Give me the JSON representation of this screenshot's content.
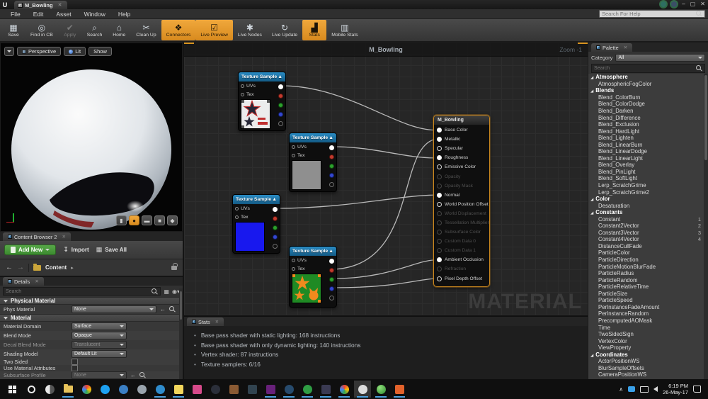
{
  "colors": {
    "accent_orange": "#E8962E",
    "node_header_blue": "#1E78A8",
    "add_new_green": "#4C9A3F",
    "wire_gray": "#C9C9C9",
    "selection_orange_border": "#C8861E"
  },
  "window": {
    "tab_title": "M_Bowling",
    "help_search_placeholder": "Search For Help",
    "menu": [
      "File",
      "Edit",
      "Asset",
      "Window",
      "Help"
    ]
  },
  "toolbar": {
    "buttons": [
      {
        "label": "Save",
        "icon": "save-icon",
        "glyph": "▦",
        "state": "normal"
      },
      {
        "label": "Find in CB",
        "icon": "find-in-cb-icon",
        "glyph": "◎",
        "state": "normal"
      },
      {
        "label": "Apply",
        "icon": "apply-icon",
        "glyph": "✔",
        "state": "disabled"
      },
      {
        "label": "Search",
        "icon": "search-icon",
        "glyph": "⌕",
        "state": "normal"
      },
      {
        "label": "Home",
        "icon": "home-icon",
        "glyph": "⌂",
        "state": "normal"
      },
      {
        "label": "Clean Up",
        "icon": "clean-up-icon",
        "glyph": "✂",
        "state": "normal"
      },
      {
        "label": "Connectors",
        "icon": "connectors-icon",
        "glyph": "❖",
        "state": "active"
      },
      {
        "label": "Live Preview",
        "icon": "live-preview-icon",
        "glyph": "☑",
        "state": "active"
      },
      {
        "label": "Live Nodes",
        "icon": "live-nodes-icon",
        "glyph": "✱",
        "state": "normal"
      },
      {
        "label": "Live Update",
        "icon": "live-update-icon",
        "glyph": "↻",
        "state": "normal"
      },
      {
        "label": "Stats",
        "icon": "stats-icon",
        "glyph": "▟",
        "state": "active"
      },
      {
        "label": "Mobile Stats",
        "icon": "mobile-stats-icon",
        "glyph": "▥",
        "state": "normal"
      }
    ]
  },
  "viewport": {
    "perspective": "Perspective",
    "lit": "Lit",
    "show": "Show"
  },
  "content_browser": {
    "tab": "Content Browser 2",
    "add_new": "Add New",
    "import": "Import",
    "save_all": "Save All",
    "path": "Content"
  },
  "details": {
    "tab": "Details",
    "search_placeholder": "Search",
    "physical_material_header": "Physical Material",
    "phys_material_label": "Phys Material",
    "phys_material_value": "None",
    "material_header": "Material",
    "rows": [
      {
        "label": "Material Domain",
        "value": "Surface",
        "state": "normal"
      },
      {
        "label": "Blend Mode",
        "value": "Opaque",
        "state": "normal"
      },
      {
        "label": "Decal Blend Mode",
        "value": "Translucent",
        "state": "disabled"
      },
      {
        "label": "Shading Model",
        "value": "Default Lit",
        "state": "normal"
      }
    ],
    "two_sided_label": "Two Sided",
    "use_material_attributes_label": "Use Material Attributes",
    "subsurface_profile_label": "Subsurface Profile",
    "subsurface_profile_value": "None"
  },
  "graph": {
    "title": "M_Bowling",
    "zoom": "Zoom -1",
    "watermark": "MATERIAL",
    "texture_node": {
      "title": "Texture Sample",
      "uvs": "UVs",
      "tex": "Tex"
    },
    "output_node": {
      "title": "M_Bowling",
      "pins": [
        {
          "label": "Base Color",
          "state": "connected"
        },
        {
          "label": "Metallic",
          "state": "connected"
        },
        {
          "label": "Specular",
          "state": "open"
        },
        {
          "label": "Roughness",
          "state": "connected"
        },
        {
          "label": "Emissive Color",
          "state": "open"
        },
        {
          "label": "Opacity",
          "state": "disabled"
        },
        {
          "label": "Opacity Mask",
          "state": "disabled"
        },
        {
          "label": "Normal",
          "state": "connected"
        },
        {
          "label": "World Position Offset",
          "state": "open"
        },
        {
          "label": "World Displacement",
          "state": "disabled"
        },
        {
          "label": "Tessellation Multiplier",
          "state": "disabled"
        },
        {
          "label": "Subsurface Color",
          "state": "disabled"
        },
        {
          "label": "Custom Data 0",
          "state": "disabled"
        },
        {
          "label": "Custom Data 1",
          "state": "disabled"
        },
        {
          "label": "Ambient Occlusion",
          "state": "connected"
        },
        {
          "label": "Refraction",
          "state": "disabled"
        },
        {
          "label": "Pixel Depth Offset",
          "state": "open"
        }
      ]
    }
  },
  "stats": {
    "tab": "Stats",
    "lines": [
      "Base pass shader with static lighting: 168 instructions",
      "Base pass shader with only dynamic lighting: 140 instructions",
      "Vertex shader: 87 instructions",
      "Texture samplers: 6/16"
    ]
  },
  "palette": {
    "tab": "Palette",
    "category_label": "Category",
    "category_value": "All",
    "search_placeholder": "Search",
    "items": [
      {
        "label": "Atmosphere",
        "type": "hdr"
      },
      {
        "label": "AtmosphericFogColor",
        "type": "itm"
      },
      {
        "label": "Blends",
        "type": "hdr"
      },
      {
        "label": "Blend_ColorBurn",
        "type": "itm"
      },
      {
        "label": "Blend_ColorDodge",
        "type": "itm"
      },
      {
        "label": "Blend_Darken",
        "type": "itm"
      },
      {
        "label": "Blend_Difference",
        "type": "itm"
      },
      {
        "label": "Blend_Exclusion",
        "type": "itm"
      },
      {
        "label": "Blend_HardLight",
        "type": "itm"
      },
      {
        "label": "Blend_Lighten",
        "type": "itm"
      },
      {
        "label": "Blend_LinearBurn",
        "type": "itm"
      },
      {
        "label": "Blend_LinearDodge",
        "type": "itm"
      },
      {
        "label": "Blend_LinearLight",
        "type": "itm"
      },
      {
        "label": "Blend_Overlay",
        "type": "itm"
      },
      {
        "label": "Blend_PinLight",
        "type": "itm"
      },
      {
        "label": "Blend_SoftLight",
        "type": "itm"
      },
      {
        "label": "Lerp_ScratchGrime",
        "type": "itm"
      },
      {
        "label": "Lerp_ScratchGrime2",
        "type": "itm"
      },
      {
        "label": "Color",
        "type": "hdr"
      },
      {
        "label": "Desaturation",
        "type": "itm"
      },
      {
        "label": "Constants",
        "type": "hdr"
      },
      {
        "label": "Constant",
        "type": "itm",
        "badge": "1"
      },
      {
        "label": "Constant2Vector",
        "type": "itm",
        "badge": "2"
      },
      {
        "label": "Constant3Vector",
        "type": "itm",
        "badge": "3"
      },
      {
        "label": "Constant4Vector",
        "type": "itm",
        "badge": "4"
      },
      {
        "label": "DistanceCullFade",
        "type": "itm"
      },
      {
        "label": "ParticleColor",
        "type": "itm"
      },
      {
        "label": "ParticleDirection",
        "type": "itm"
      },
      {
        "label": "ParticleMotionBlurFade",
        "type": "itm"
      },
      {
        "label": "ParticleRadius",
        "type": "itm"
      },
      {
        "label": "ParticleRandom",
        "type": "itm"
      },
      {
        "label": "ParticleRelativeTime",
        "type": "itm"
      },
      {
        "label": "ParticleSize",
        "type": "itm"
      },
      {
        "label": "ParticleSpeed",
        "type": "itm"
      },
      {
        "label": "PerInstanceFadeAmount",
        "type": "itm"
      },
      {
        "label": "PerInstanceRandom",
        "type": "itm"
      },
      {
        "label": "PrecomputedAOMask",
        "type": "itm"
      },
      {
        "label": "Time",
        "type": "itm"
      },
      {
        "label": "TwoSidedSign",
        "type": "itm"
      },
      {
        "label": "VertexColor",
        "type": "itm"
      },
      {
        "label": "ViewProperty",
        "type": "itm"
      },
      {
        "label": "Coordinates",
        "type": "hdr"
      },
      {
        "label": "ActorPositionWS",
        "type": "itm"
      },
      {
        "label": "BlurSampleOffsets",
        "type": "itm"
      },
      {
        "label": "CameraPositionWS",
        "type": "itm"
      }
    ]
  },
  "taskbar": {
    "time": "6:19 PM",
    "date": "26-May-17",
    "icons": [
      {
        "name": "cortana-icon",
        "color": "transparent",
        "shape": "ring",
        "state": "normal"
      },
      {
        "name": "contrast-circle-icon",
        "color": "linear-gradient(90deg,#e8e8e8 50%,#555 50%)",
        "shape": "circle",
        "state": "normal"
      },
      {
        "name": "file-explorer-icon",
        "color": "#e8c35a",
        "shape": "folder",
        "state": "open"
      },
      {
        "name": "chrome-icon",
        "color": "conic-gradient(#ea4335,#fbbc05,#34a853,#4285f4,#ea4335)",
        "shape": "circle",
        "state": "normal"
      },
      {
        "name": "twitter-icon",
        "color": "#1da1f2",
        "shape": "circle",
        "state": "normal"
      },
      {
        "name": "globe-icon",
        "color": "#3b7fc4",
        "shape": "circle",
        "state": "normal"
      },
      {
        "name": "camera-icon",
        "color": "#9aa4ad",
        "shape": "circle",
        "state": "normal"
      },
      {
        "name": "edge-icon",
        "color": "#2f8ccc",
        "shape": "circle",
        "state": "open"
      },
      {
        "name": "sticky-notes-icon",
        "color": "#f2d65c",
        "shape": "square",
        "state": "open"
      },
      {
        "name": "photos-icon",
        "color": "#d64a8a",
        "shape": "square",
        "state": "normal"
      },
      {
        "name": "steam-icon",
        "color": "#2b2f3a",
        "shape": "circle",
        "state": "normal"
      },
      {
        "name": "package-icon",
        "color": "#8a5a33",
        "shape": "square",
        "state": "normal"
      },
      {
        "name": "photoshop-icon",
        "color": "#31434f",
        "shape": "square",
        "state": "normal"
      },
      {
        "name": "visual-studio-icon",
        "color": "#68217a",
        "shape": "square",
        "state": "open"
      },
      {
        "name": "paw-app-icon",
        "color": "#274b6d",
        "shape": "circle",
        "state": "open"
      },
      {
        "name": "shield-icon",
        "color": "#2f9e44",
        "shape": "circle",
        "state": "open"
      },
      {
        "name": "premiere-icon",
        "color": "#3a3a52",
        "shape": "square",
        "state": "open"
      },
      {
        "name": "chrome-alt-icon",
        "color": "conic-gradient(#ea4335,#fbbc05,#34a853,#4285f4,#ea4335)",
        "shape": "circle",
        "state": "open"
      },
      {
        "name": "unreal-engine-icon",
        "color": "#dcdcdc",
        "shape": "circle",
        "state": "active"
      },
      {
        "name": "green-sphere-icon",
        "color": "radial-gradient(circle at 35% 30%,#8fe07a,#2f8a2f)",
        "shape": "circle",
        "state": "open"
      },
      {
        "name": "media-app-icon",
        "color": "#e2622b",
        "shape": "square",
        "state": "open"
      }
    ]
  }
}
